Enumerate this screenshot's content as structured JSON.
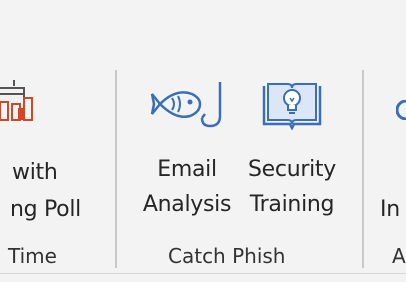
{
  "ribbon": {
    "left_button": {
      "line1": "with",
      "line2": "ng Poll"
    },
    "left_group_label": "Time",
    "email_analysis": {
      "line1": "Email",
      "line2": "Analysis",
      "icon": "fish-icon"
    },
    "security_training": {
      "line1": "Security",
      "line2": "Training",
      "icon": "lightbulb-book-icon"
    },
    "catch_group_label": "Catch Phish",
    "right_button": {
      "line1": "In"
    },
    "right_group_label": "A"
  }
}
